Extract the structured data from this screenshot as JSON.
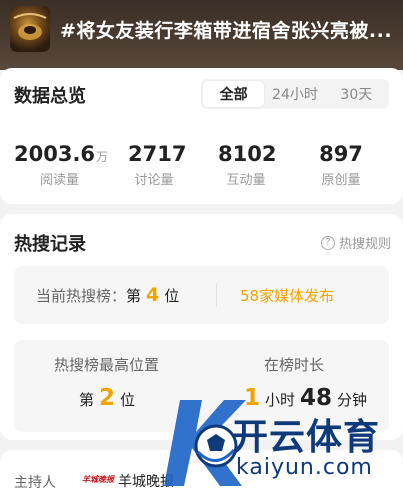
{
  "header": {
    "title": "#将女友装行李箱带进宿舍张兴亮被..."
  },
  "overview": {
    "title": "数据总览",
    "tabs": [
      {
        "label": "全部",
        "active": true
      },
      {
        "label": "24小时",
        "active": false
      },
      {
        "label": "30天",
        "active": false
      }
    ],
    "stats": [
      {
        "value": "2003.6",
        "unit": "万",
        "label": "阅读量"
      },
      {
        "value": "2717",
        "unit": "",
        "label": "讨论量"
      },
      {
        "value": "8102",
        "unit": "",
        "label": "互动量"
      },
      {
        "value": "897",
        "unit": "",
        "label": "原创量"
      }
    ]
  },
  "hot": {
    "title": "热搜记录",
    "rules_label": "热搜规则",
    "current_prefix": "当前热搜榜：",
    "current_di": "第",
    "current_rank": "4",
    "current_wei": "位",
    "media_link": "58家媒体发布",
    "best_label": "热搜榜最高位置",
    "best_di": "第",
    "best_rank": "2",
    "best_wei": "位",
    "duration_label": "在榜时长",
    "duration_hours": "1",
    "duration_hours_unit": "小时",
    "duration_minutes": "48",
    "duration_minutes_unit": "分钟"
  },
  "host": {
    "label": "主持人",
    "logo_text": "羊城晚报",
    "name": "羊城晚报"
  },
  "watermark": {
    "text": "开云体育",
    "sub": "kaiyun.com"
  },
  "colors": {
    "accent": "#f0a400",
    "header_bg": "#3a2f27",
    "watermark_blue": "#0e3a7a"
  }
}
